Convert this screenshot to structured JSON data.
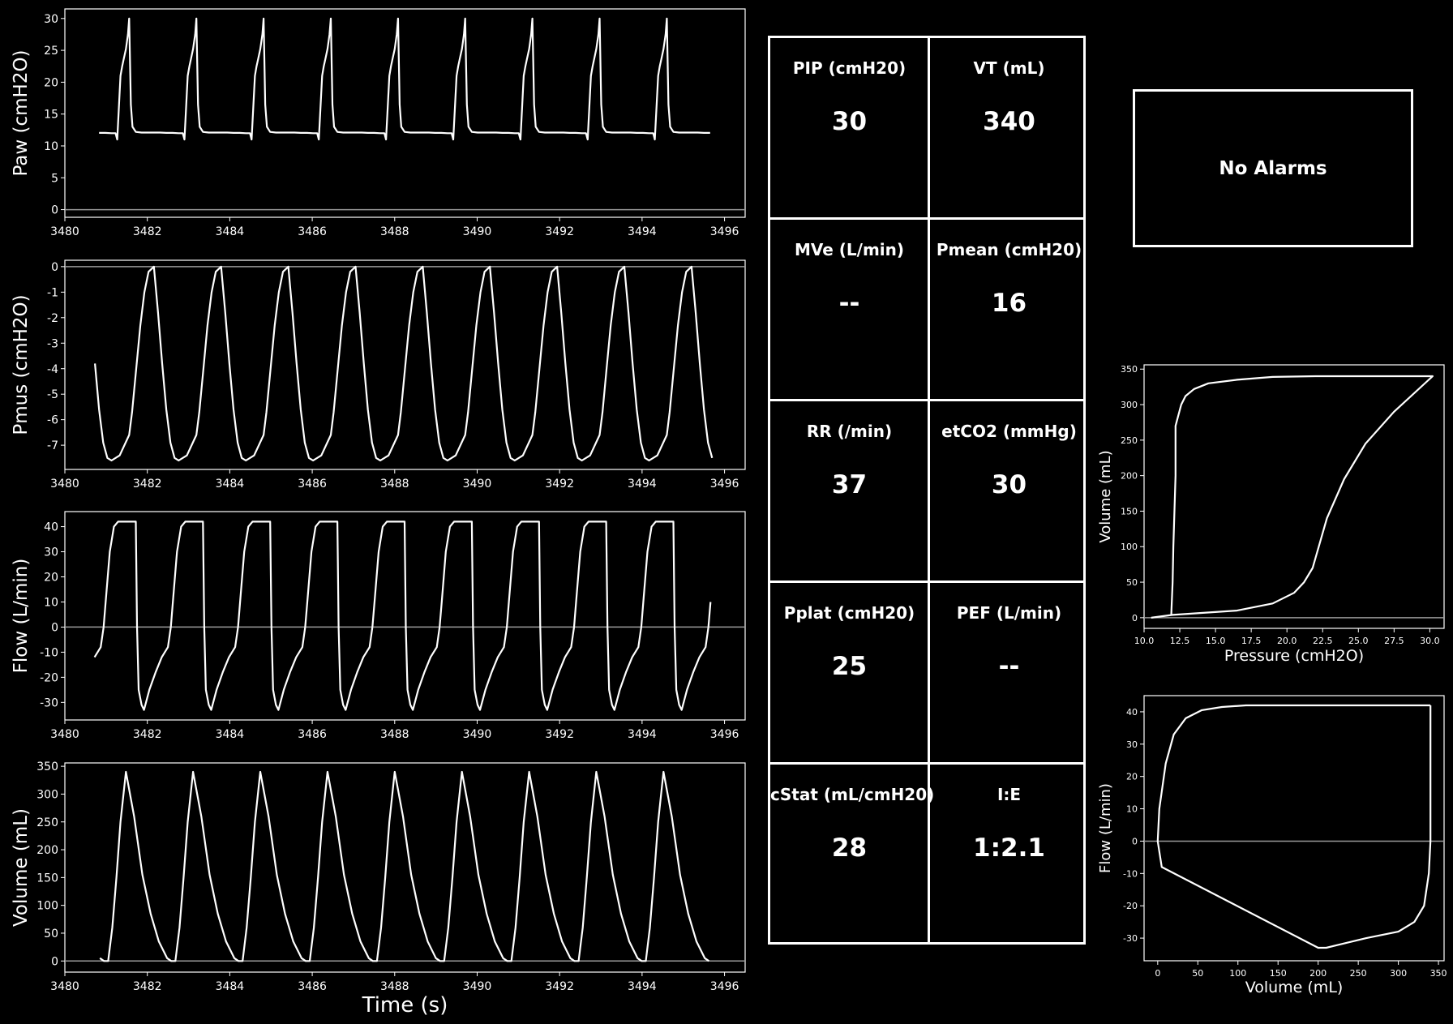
{
  "colors": {
    "background": "#000000",
    "foreground": "#ffffff",
    "zero_line": "#9a9a9a"
  },
  "alarm_text": "No Alarms",
  "metrics": [
    {
      "label": "PIP (cmH20)",
      "value": "30"
    },
    {
      "label": "VT (mL)",
      "value": "340"
    },
    {
      "label": "MVe (L/min)",
      "value": "--"
    },
    {
      "label": "Pmean (cmH20)",
      "value": "16"
    },
    {
      "label": "RR (/min)",
      "value": "37"
    },
    {
      "label": "etCO2 (mmHg)",
      "value": "30"
    },
    {
      "label": "Pplat (cmH20)",
      "value": "25"
    },
    {
      "label": "PEF (L/min)",
      "value": "--"
    },
    {
      "label": "cStat (mL/cmH20)",
      "value": "28"
    },
    {
      "label": "I:E",
      "value": "1:2.1"
    }
  ],
  "chart_data": [
    {
      "type": "line",
      "id": "paw",
      "xlabel": "",
      "ylabel": "Paw (cmH2O)",
      "xlim": [
        3480,
        3496.5
      ],
      "ylim": [
        -1.2,
        31.5
      ],
      "xticks": [
        3480,
        3482,
        3484,
        3486,
        3488,
        3490,
        3492,
        3494,
        3496
      ],
      "yticks": [
        0,
        5,
        10,
        15,
        20,
        25,
        30
      ],
      "zero_line": true,
      "waveform": {
        "start": 3480.7,
        "end": 3495.7,
        "period": 1.63,
        "phase_offset": -0.12,
        "cycle_t": [
          0,
          0.04,
          0.08,
          0.16,
          0.3,
          0.45,
          0.6,
          0.75,
          0.9,
          1.05,
          1.2,
          1.3,
          1.34,
          1.42,
          1.46,
          1.5,
          1.55,
          1.6,
          1.63
        ],
        "cycle_y": [
          30,
          16.5,
          13,
          12.2,
          12.1,
          12.1,
          12.1,
          12.1,
          12.05,
          12.05,
          12,
          12,
          11,
          21,
          22.5,
          23.7,
          25.2,
          27.5,
          30
        ]
      }
    },
    {
      "type": "line",
      "id": "pmus",
      "xlabel": "",
      "ylabel": "Pmus (cmH2O)",
      "xlim": [
        3480,
        3496.5
      ],
      "ylim": [
        -7.95,
        0.25
      ],
      "xticks": [
        3480,
        3482,
        3484,
        3486,
        3488,
        3490,
        3492,
        3494,
        3496
      ],
      "yticks": [
        0,
        -1,
        -2,
        -3,
        -4,
        -5,
        -6,
        -7
      ],
      "zero_line": true,
      "waveform": {
        "start": 3480.7,
        "end": 3495.7,
        "period": 1.63,
        "phase_offset": 0.48,
        "cycle_t": [
          0,
          0.1,
          0.2,
          0.3,
          0.4,
          0.5,
          0.6,
          0.8,
          1.03,
          1.1,
          1.2,
          1.3,
          1.4,
          1.5,
          1.63
        ],
        "cycle_y": [
          0,
          -1.8,
          -3.8,
          -5.6,
          -6.9,
          -7.5,
          -7.6,
          -7.4,
          -6.6,
          -5.7,
          -4,
          -2.3,
          -1,
          -0.2,
          0
        ]
      }
    },
    {
      "type": "line",
      "id": "flow",
      "xlabel": "",
      "ylabel": "Flow (L/min)",
      "xlim": [
        3480,
        3496.5
      ],
      "ylim": [
        -37,
        46
      ],
      "xticks": [
        3480,
        3482,
        3484,
        3486,
        3488,
        3490,
        3492,
        3494,
        3496
      ],
      "yticks": [
        40,
        30,
        20,
        10,
        0,
        -10,
        -20,
        -30
      ],
      "zero_line": true,
      "waveform": {
        "start": 3480.7,
        "end": 3495.7,
        "period": 1.63,
        "phase_offset": -0.06,
        "cycle_t": [
          0,
          0.1,
          0.13,
          0.17,
          0.24,
          0.3,
          0.43,
          0.58,
          0.73,
          0.88,
          0.95,
          1.0,
          1.1,
          1.2,
          1.3,
          1.44,
          1.5,
          1.59,
          1.63
        ],
        "cycle_y": [
          42,
          42,
          0,
          -25,
          -31,
          -33,
          -25,
          -18,
          -12,
          -8,
          0,
          10,
          30,
          40,
          42,
          42,
          42,
          42,
          42
        ]
      }
    },
    {
      "type": "line",
      "id": "volume",
      "xlabel": "Time (s)",
      "ylabel": "Volume (mL)",
      "xlim": [
        3480,
        3496.5
      ],
      "ylim": [
        -20,
        356
      ],
      "xticks": [
        3480,
        3482,
        3484,
        3486,
        3488,
        3490,
        3492,
        3494,
        3496
      ],
      "yticks": [
        0,
        50,
        100,
        150,
        200,
        250,
        300,
        350
      ],
      "zero_line": true,
      "waveform": {
        "start": 3480.7,
        "end": 3495.7,
        "period": 1.63,
        "phase_offset": -0.2,
        "cycle_t": [
          0,
          0.2,
          0.4,
          0.6,
          0.8,
          1.0,
          1.1,
          1.2,
          1.3,
          1.4,
          1.5,
          1.63
        ],
        "cycle_y": [
          340,
          260,
          155,
          85,
          35,
          5,
          0,
          0,
          60,
          150,
          250,
          340
        ]
      }
    },
    {
      "type": "line",
      "id": "pv_loop",
      "xlabel": "Pressure (cmH2O)",
      "ylabel": "Volume (mL)",
      "xlim": [
        10,
        31
      ],
      "ylim": [
        -15,
        356
      ],
      "xticks": [
        10.0,
        12.5,
        15.0,
        17.5,
        20.0,
        22.5,
        25.0,
        27.5,
        30.0
      ],
      "yticks": [
        0,
        50,
        100,
        150,
        200,
        250,
        300,
        350
      ],
      "zero_line": true,
      "x": [
        10.5,
        12.0,
        16.5,
        19.0,
        20.5,
        21.2,
        21.8,
        22.8,
        24.0,
        25.5,
        27.5,
        30.2,
        30.2,
        22.0,
        19.0,
        16.5,
        14.5,
        13.5,
        12.9,
        12.6,
        12.4,
        12.2,
        12.2,
        12.05,
        12.0,
        11.9
      ],
      "y": [
        0,
        4,
        10,
        20,
        35,
        50,
        70,
        140,
        195,
        245,
        290,
        340,
        340,
        340,
        339,
        335,
        330,
        322,
        312,
        300,
        285,
        270,
        200,
        100,
        50,
        3
      ]
    },
    {
      "type": "line",
      "id": "flow_volume_loop",
      "xlabel": "Volume (mL)",
      "ylabel": "Flow (L/min)",
      "xlim": [
        -17,
        357
      ],
      "ylim": [
        -37,
        45
      ],
      "xticks": [
        0,
        50,
        100,
        150,
        200,
        250,
        300,
        350
      ],
      "yticks": [
        40,
        30,
        20,
        10,
        0,
        -10,
        -20,
        -30
      ],
      "zero_line": true,
      "x": [
        340,
        340,
        338,
        332,
        320,
        300,
        260,
        210,
        200,
        5,
        0,
        2,
        10,
        20,
        35,
        55,
        80,
        110,
        150,
        340
      ],
      "y": [
        42,
        0,
        -10,
        -20,
        -25,
        -28,
        -30,
        -33,
        -33,
        -8,
        0,
        10,
        24,
        33,
        38,
        40.5,
        41.5,
        42,
        42,
        42
      ]
    }
  ]
}
